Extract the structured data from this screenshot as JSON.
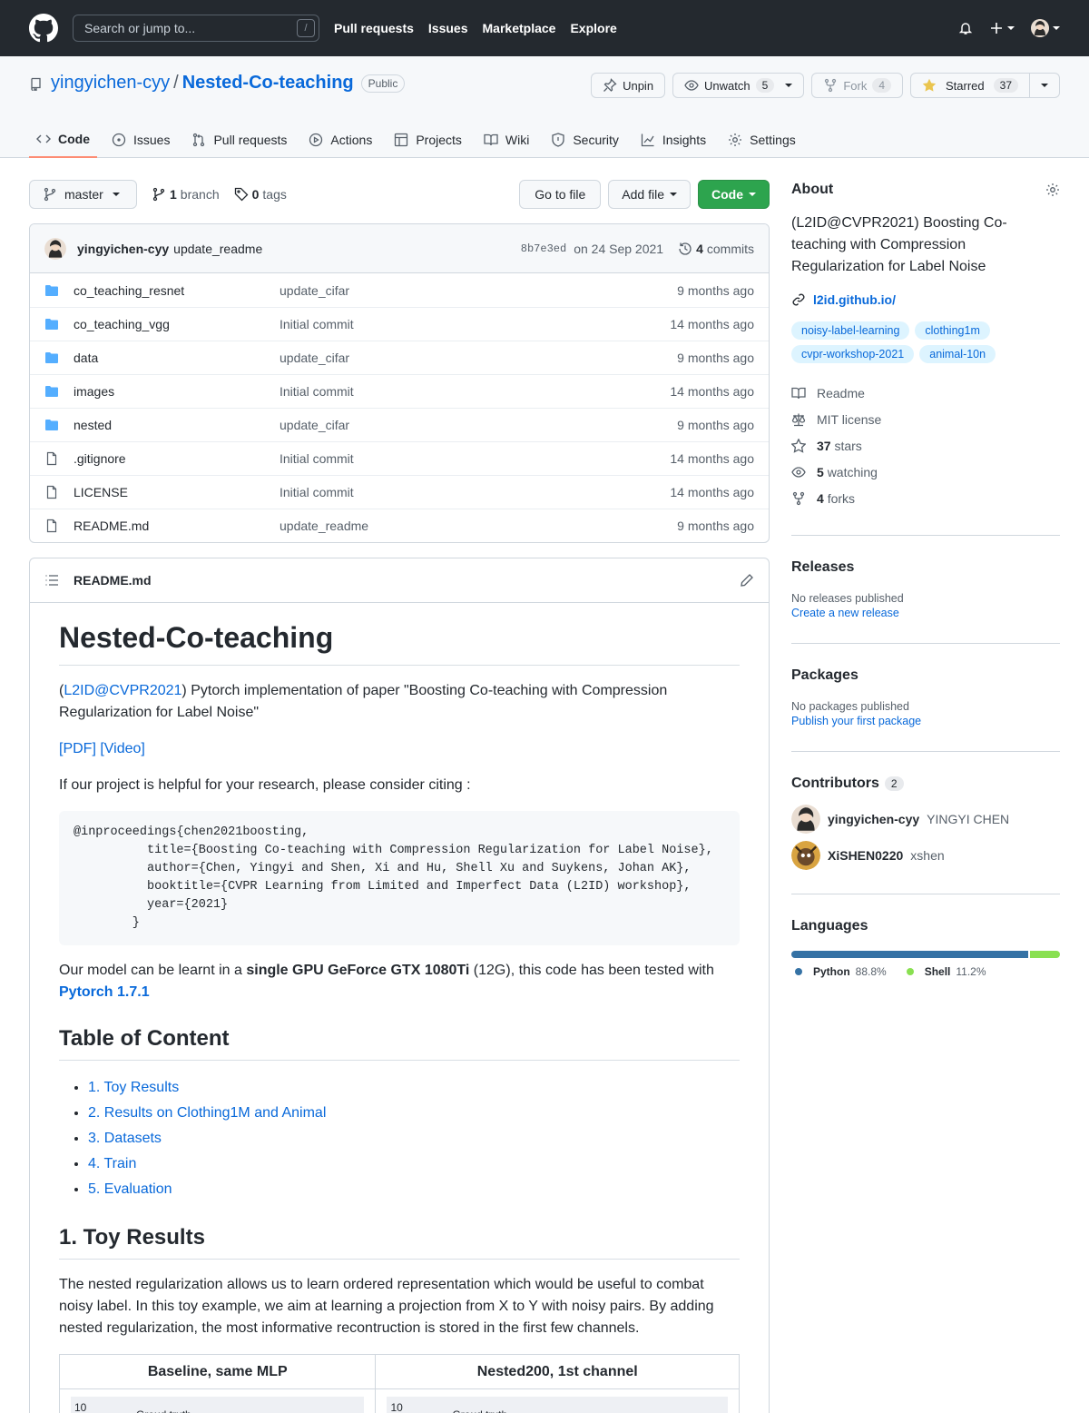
{
  "header": {
    "search_placeholder": "Search or jump to...",
    "slash": "/",
    "nav": [
      "Pull requests",
      "Issues",
      "Marketplace",
      "Explore"
    ]
  },
  "repo": {
    "owner": "yingyichen-cyy",
    "sep": "/",
    "name": "Nested-Co-teaching",
    "visibility": "Public",
    "unpin": "Unpin",
    "unwatch": "Unwatch",
    "watch_count": "5",
    "fork": "Fork",
    "fork_count": "4",
    "starred": "Starred",
    "star_count": "37"
  },
  "tabs": [
    "Code",
    "Issues",
    "Pull requests",
    "Actions",
    "Projects",
    "Wiki",
    "Security",
    "Insights",
    "Settings"
  ],
  "toolbar": {
    "branch": "master",
    "branches_num": "1",
    "branches_label": "branch",
    "tags_num": "0",
    "tags_label": "tags",
    "go_to_file": "Go to file",
    "add_file": "Add file",
    "code": "Code"
  },
  "commit": {
    "author": "yingyichen-cyy",
    "message": "update_readme",
    "sha": "8b7e3ed",
    "date": "on 24 Sep 2021",
    "count": "4",
    "count_label": "commits"
  },
  "files": [
    {
      "name": "co_teaching_resnet",
      "msg": "update_cifar",
      "age": "9 months ago",
      "type": "dir"
    },
    {
      "name": "co_teaching_vgg",
      "msg": "Initial commit",
      "age": "14 months ago",
      "type": "dir"
    },
    {
      "name": "data",
      "msg": "update_cifar",
      "age": "9 months ago",
      "type": "dir"
    },
    {
      "name": "images",
      "msg": "Initial commit",
      "age": "14 months ago",
      "type": "dir"
    },
    {
      "name": "nested",
      "msg": "update_cifar",
      "age": "9 months ago",
      "type": "dir"
    },
    {
      "name": ".gitignore",
      "msg": "Initial commit",
      "age": "14 months ago",
      "type": "file"
    },
    {
      "name": "LICENSE",
      "msg": "Initial commit",
      "age": "14 months ago",
      "type": "file"
    },
    {
      "name": "README.md",
      "msg": "update_readme",
      "age": "9 months ago",
      "type": "file"
    }
  ],
  "readme": {
    "file": "README.md",
    "title": "Nested-Co-teaching",
    "intro_link": "L2ID@CVPR2021",
    "intro_open": "(",
    "intro_rest": ") Pytorch implementation of paper \"Boosting Co-teaching with Compression Regularization for Label Noise\"",
    "links": "[PDF] [Video]",
    "cite": "If our project is helpful for your research, please consider citing :",
    "bibtex": "@inproceedings{chen2021boosting,\n          title={Boosting Co-teaching with Compression Regularization for Label Noise},\n          author={Chen, Yingyi and Shen, Xi and Hu, Shell Xu and Suykens, Johan AK},\n          booktitle={CVPR Learning from Limited and Imperfect Data (L2ID) workshop},\n          year={2021}\n        }",
    "gpu_pre": "Our model can be learnt in a ",
    "gpu_bold": "single GPU GeForce GTX 1080Ti",
    "gpu_post": " (12G), this code has been tested with ",
    "pytorch": "Pytorch 1.7.1",
    "toc_title": "Table of Content",
    "toc": [
      "1. Toy Results",
      "2. Results on Clothing1M and Animal",
      "3. Datasets",
      "4. Train",
      "5. Evaluation"
    ],
    "toy_title": "1. Toy Results",
    "toy_text": "The nested regularization allows us to learn ordered representation which would be useful to combat noisy label. In this toy example, we aim at learning a projection from X to Y with noisy pairs. By adding nested regularization, the most informative recontruction is stored in the first few channels.",
    "table_headers": [
      "Baseline, same MLP",
      "Nested200, 1st channel"
    ],
    "plot_tick": "10",
    "plot_legend": "Groud truth"
  },
  "about": {
    "title": "About",
    "desc": "(L2ID@CVPR2021) Boosting Co-teaching with Compression Regularization for Label Noise",
    "url": "l2id.github.io/",
    "topics": [
      "noisy-label-learning",
      "clothing1m",
      "cvpr-workshop-2021",
      "animal-10n"
    ],
    "readme": "Readme",
    "license": "MIT license",
    "stars_num": "37",
    "stars": "stars",
    "watching_num": "5",
    "watching": "watching",
    "forks_num": "4",
    "forks": "forks"
  },
  "releases": {
    "title": "Releases",
    "none": "No releases published",
    "create": "Create a new release"
  },
  "packages": {
    "title": "Packages",
    "none": "No packages published",
    "publish": "Publish your first package"
  },
  "contributors": {
    "title": "Contributors",
    "count": "2",
    "list": [
      {
        "login": "yingyichen-cyy",
        "name": "YINGYI CHEN"
      },
      {
        "login": "XiSHEN0220",
        "name": "xshen"
      }
    ]
  },
  "languages": {
    "title": "Languages",
    "items": [
      {
        "name": "Python",
        "pct": "88.8%",
        "value": 88.8,
        "color": "#3572A5"
      },
      {
        "name": "Shell",
        "pct": "11.2%",
        "value": 11.2,
        "color": "#89e051"
      }
    ]
  }
}
